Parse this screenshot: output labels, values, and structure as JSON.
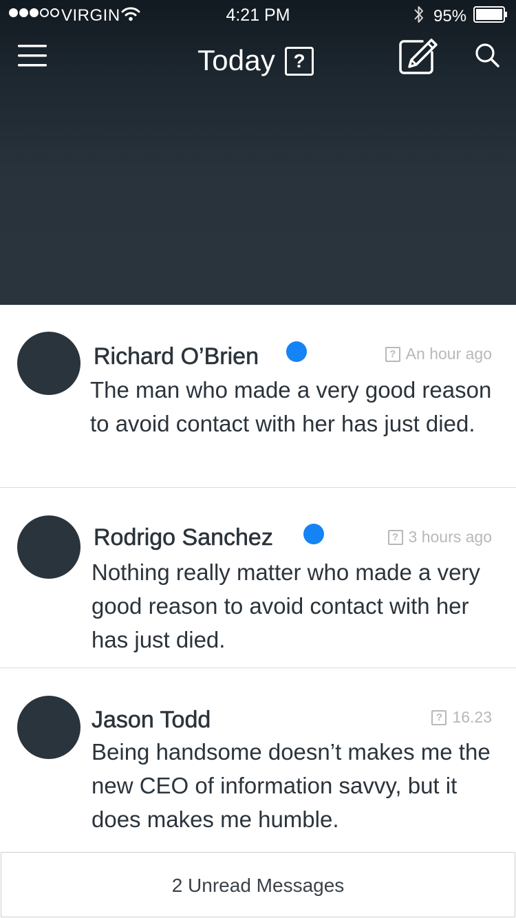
{
  "status_bar": {
    "carrier": "VIRGIN",
    "time": "4:21 PM",
    "battery": "95%",
    "signal_bars_filled": 3,
    "signal_bars_total": 5
  },
  "nav": {
    "menu_icon": "hamburger-menu-icon",
    "title": "Today",
    "title_badge": "?",
    "compose_icon": "compose-icon",
    "search_icon": "search-icon"
  },
  "messages": [
    {
      "sender": "Richard O’Brien",
      "unread": true,
      "time_icon": "?",
      "time": "An hour ago",
      "snippet": "The man who made a very good reason to avoid contact with her has just died."
    },
    {
      "sender": "Rodrigo Sanchez",
      "unread": true,
      "time_icon": "?",
      "time": "3 hours ago",
      "snippet": "Nothing really matter who made a very good reason to avoid contact with her has just died."
    },
    {
      "sender": "Jason Todd",
      "unread": false,
      "time_icon": "?",
      "time": "16.23",
      "snippet": "Being handsome doesn’t makes me the new CEO of information savvy, but it does makes me humble."
    }
  ],
  "footer": {
    "unread_label": "2 Unread Messages"
  },
  "colors": {
    "header_bg": "#2a343c",
    "avatar_bg": "#2a343c",
    "unread_dot": "#1483f5",
    "text_dark": "#2b333b",
    "text_muted": "#b8b8b8"
  }
}
